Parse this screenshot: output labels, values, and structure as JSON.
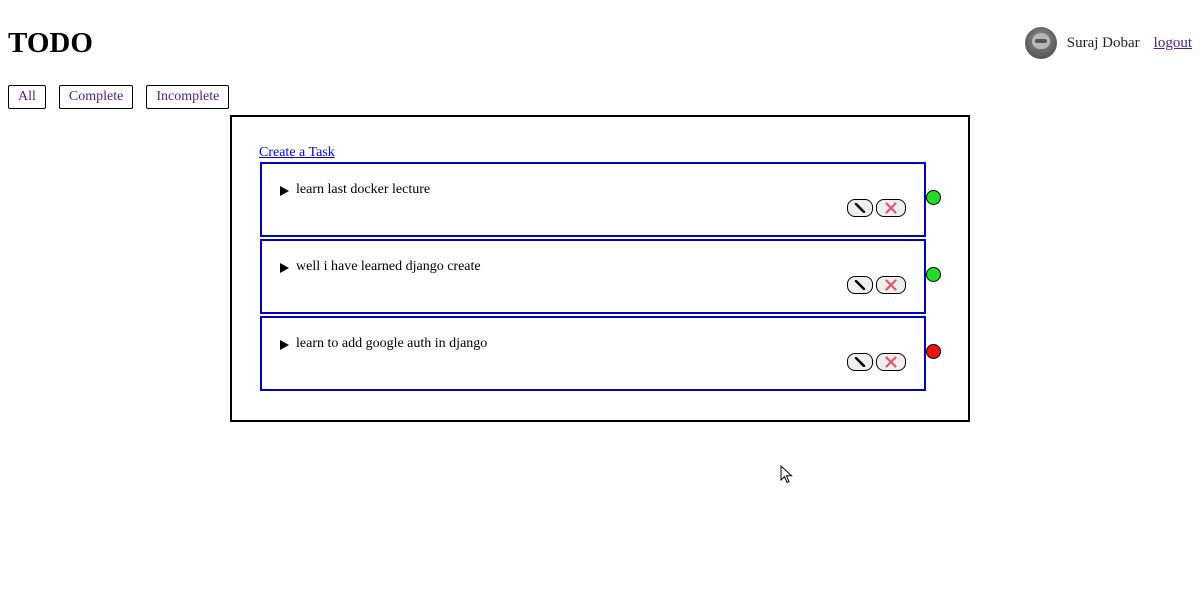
{
  "header": {
    "title": "TODO",
    "user_name": "Suraj Dobar",
    "logout_label": "logout"
  },
  "filters": [
    {
      "label": "All"
    },
    {
      "label": "Complete"
    },
    {
      "label": "Incomplete"
    }
  ],
  "panel": {
    "create_label": "Create a Task"
  },
  "tasks": [
    {
      "title": "learn last docker lecture",
      "status": "complete",
      "status_color": "#22dd22"
    },
    {
      "title": "well i have learned django create",
      "status": "complete",
      "status_color": "#22dd22"
    },
    {
      "title": "learn to add google auth in django",
      "status": "incomplete",
      "status_color": "#ee1111"
    }
  ],
  "icons": {
    "edit": "pencil-icon",
    "delete": "close-icon",
    "expand": "triangle-right-icon"
  },
  "colors": {
    "link": "#0000ee",
    "visited_link": "#551a8b",
    "card_border": "#0000cc",
    "delete_x": "#e8536b"
  }
}
